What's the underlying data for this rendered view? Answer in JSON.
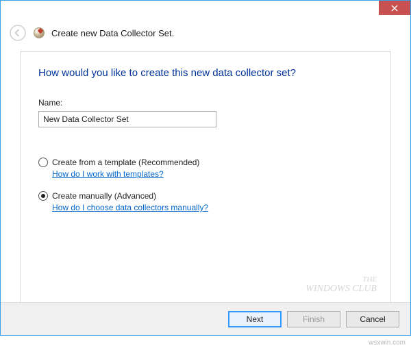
{
  "titlebar": {
    "close_tooltip": "Close"
  },
  "header": {
    "title": "Create new Data Collector Set."
  },
  "content": {
    "question": "How would you like to create this new data collector set?",
    "name_label": "Name:",
    "name_value": "New Data Collector Set",
    "options": [
      {
        "label": "Create from a template (Recommended)",
        "help": "How do I work with templates?",
        "checked": false
      },
      {
        "label": "Create manually (Advanced)",
        "help": "How do I choose data collectors manually?",
        "checked": true
      }
    ]
  },
  "watermark": {
    "line1": "THE",
    "line2": "WINDOWS CLUB"
  },
  "footer": {
    "next": "Next",
    "finish": "Finish",
    "cancel": "Cancel"
  },
  "source": "wsxwin.com"
}
